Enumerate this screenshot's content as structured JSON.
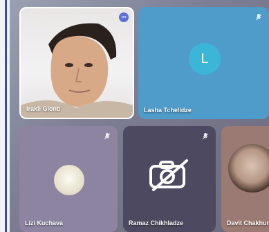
{
  "participants": [
    {
      "name": "Irakli Glonti",
      "type": "video"
    },
    {
      "name": "Lasha Tchelidze",
      "type": "avatar",
      "avatar_letter": "L"
    },
    {
      "name": "Lizi Kuchava",
      "type": "video-small"
    },
    {
      "name": "Ramaz Chikhladze",
      "type": "camera-off"
    },
    {
      "name": "Davit Chakhunashvili",
      "type": "video"
    }
  ],
  "colors": {
    "accent_active_speaker": "#5b6fd6",
    "avatar_tile_bg": "#4f9bc9",
    "avatar_circle": "#3bb6d9"
  },
  "icons": {
    "speaking": "speaking-indicator-icon",
    "muted": "mic-muted-icon",
    "camera_off": "camera-off-icon"
  }
}
